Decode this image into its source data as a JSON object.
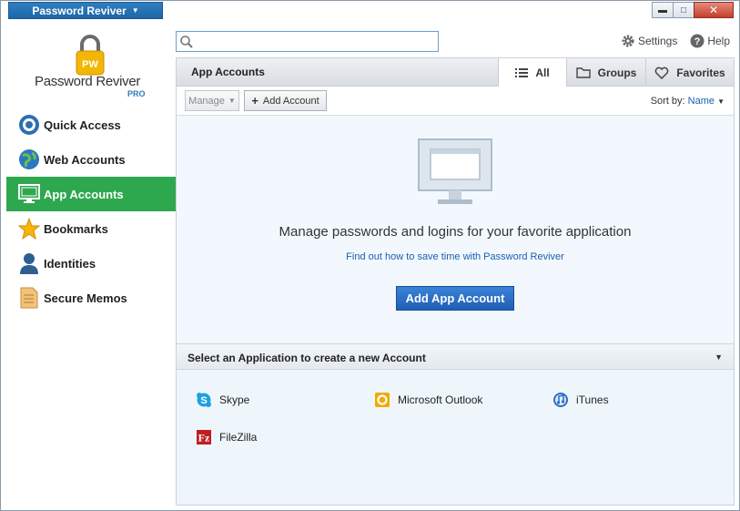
{
  "titlebar": {
    "app_menu_label": "Password Reviver",
    "minimize": "▬",
    "maximize": "□",
    "close": "✕"
  },
  "logo": {
    "badge": "PW",
    "name": "Password Reviver",
    "edition": "PRO"
  },
  "sidebar": {
    "items": [
      {
        "label": "Quick Access",
        "icon": "quick-access-icon"
      },
      {
        "label": "Web Accounts",
        "icon": "globe-icon"
      },
      {
        "label": "App Accounts",
        "icon": "monitor-icon",
        "active": true
      },
      {
        "label": "Bookmarks",
        "icon": "star-icon"
      },
      {
        "label": "Identities",
        "icon": "person-icon"
      },
      {
        "label": "Secure Memos",
        "icon": "memo-icon"
      }
    ]
  },
  "search": {
    "value": "",
    "placeholder": ""
  },
  "top_links": {
    "settings": "Settings",
    "help": "Help"
  },
  "panel": {
    "title": "App Accounts",
    "tabs": [
      {
        "label": "All",
        "icon": "list-icon",
        "active": true
      },
      {
        "label": "Groups",
        "icon": "folder-icon"
      },
      {
        "label": "Favorites",
        "icon": "heart-icon"
      }
    ]
  },
  "toolbar": {
    "manage_label": "Manage",
    "add_account_label": "Add Account",
    "sort_label": "Sort by:",
    "sort_value": "Name"
  },
  "empty_state": {
    "title": "Manage passwords and logins for your favorite application",
    "link": "Find out how to save time with Password Reviver",
    "button": "Add App Account"
  },
  "apps": {
    "header": "Select an Application to create a new Account",
    "items": [
      {
        "label": "Skype",
        "icon": "skype-icon"
      },
      {
        "label": "Microsoft Outlook",
        "icon": "outlook-icon"
      },
      {
        "label": "iTunes",
        "icon": "itunes-icon"
      },
      {
        "label": "FileZilla",
        "icon": "filezilla-icon"
      }
    ]
  },
  "colors": {
    "active_nav": "#2ea84f",
    "accent_blue": "#1f5fb3",
    "title_blue": "#1e66a8"
  }
}
